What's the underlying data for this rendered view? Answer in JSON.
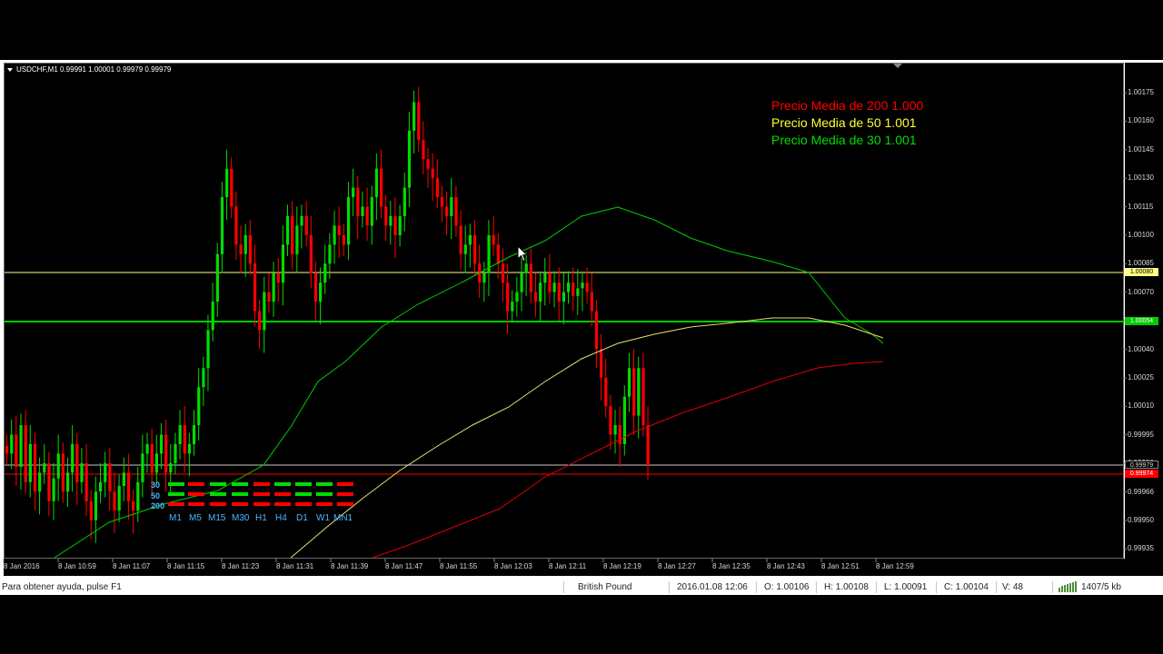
{
  "chart": {
    "symbol_line": "USDCHF,M1  0.99991 1.00001 0.99979 0.99979",
    "y_ticks": [
      "1.00175",
      "1.00160",
      "1.00145",
      "1.00130",
      "1.00115",
      "1.00100",
      "1.00085",
      "1.00070",
      "1.00055",
      "1.00040",
      "1.00025",
      "1.00010",
      "0.99995",
      "0.99980",
      "0.99966",
      "0.99950",
      "0.99935"
    ],
    "x_ticks": [
      "8 Jan 2016",
      "8 Jan 10:59",
      "8 Jan 11:07",
      "8 Jan 11:15",
      "8 Jan 11:23",
      "8 Jan 11:31",
      "8 Jan 11:39",
      "8 Jan 11:47",
      "8 Jan 11:55",
      "8 Jan 12:03",
      "8 Jan 12:11",
      "8 Jan 12:19",
      "8 Jan 12:27",
      "8 Jan 12:35",
      "8 Jan 12:43",
      "8 Jan 12:51",
      "8 Jan 12:59"
    ],
    "price_tags": [
      {
        "value": "1.00080",
        "color": "#ffff80",
        "text_color": "#000"
      },
      {
        "value": "1.00054",
        "color": "#00cc00",
        "text_color": "#fff"
      },
      {
        "value": "0.99979",
        "color": "#000",
        "text_color": "#d8d8d8"
      },
      {
        "value": "0.99974",
        "color": "#ff0000",
        "text_color": "#fff"
      }
    ],
    "legend": [
      {
        "text": "Precio Media de 200  1.000",
        "color": "#ff0000"
      },
      {
        "text": "Precio Media de 50  1.001",
        "color": "#ffff33"
      },
      {
        "text": "Precio Media de 30  1.001",
        "color": "#00dd00"
      }
    ],
    "ma_periods": [
      "30",
      "50",
      "200"
    ],
    "timeframes": [
      "M1",
      "M5",
      "M15",
      "M30",
      "H1",
      "H4",
      "D1",
      "W1",
      "MN1"
    ],
    "colors": {
      "bull": "#00dd00",
      "bear": "#ff0000",
      "ma30": "#00cc00",
      "ma50": "#e8e070",
      "ma200": "#dd0000",
      "hline_yellow": "#ffff80",
      "hline_green": "#00cc00",
      "hline_red": "#ff0000",
      "hline_white": "#c8c8c8"
    }
  },
  "status": {
    "help": "Para obtener ayuda, pulse F1",
    "profile": "British Pound",
    "datetime": "2016.01.08 12:06",
    "open": "O: 1.00106",
    "high": "H: 1.00108",
    "low": "L: 1.00091",
    "close": "C: 1.00104",
    "volume": "V: 48",
    "traffic": "1407/5 kb"
  }
}
